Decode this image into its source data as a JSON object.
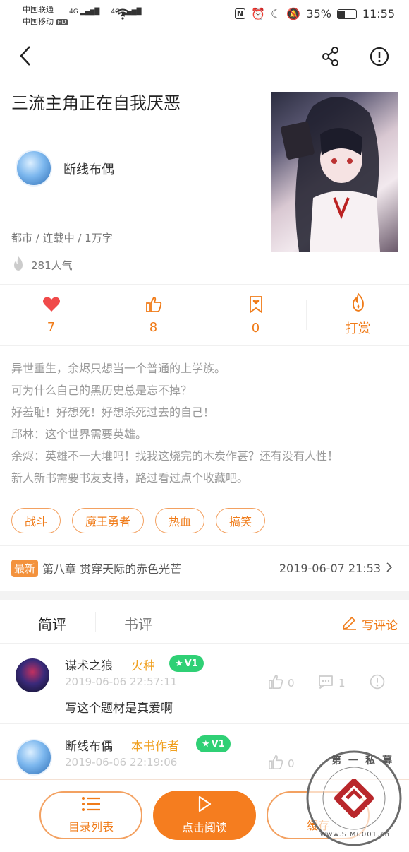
{
  "status_bar": {
    "carrier1": "中国联通",
    "carrier2": "中国移动",
    "hd": "HD",
    "net1": "4G",
    "net2": "4G",
    "battery": "35%",
    "time": "11:55"
  },
  "book": {
    "title": "三流主角正在自我厌恶",
    "author": "断线布偶",
    "meta": "都市 / 连载中 / 1万字",
    "popularity": "281人气"
  },
  "stats": [
    {
      "icon": "heart-icon",
      "value": "7"
    },
    {
      "icon": "thumbs-up-icon",
      "value": "8"
    },
    {
      "icon": "bookmark-icon",
      "value": "0"
    },
    {
      "icon": "flame-icon",
      "value": "打赏"
    }
  ],
  "description": [
    "异世重生，余烬只想当一个普通的上学族。",
    "可为什么自己的黑历史总是忘不掉？",
    "好羞耻！好想死！好想杀死过去的自己！",
    "邱林：这个世界需要英雄。",
    "余烬：英雄不一大堆吗！找我这烧完的木炭作甚？还有没有人性！",
    "新人新书需要书友支持，路过看过点个收藏吧。"
  ],
  "tags": [
    "战斗",
    "魔王勇者",
    "热血",
    "搞笑"
  ],
  "latest": {
    "badge": "最新",
    "chapter": "第八章 贯穿天际的赤色光芒",
    "time": "2019-06-07 21:53"
  },
  "tabs": {
    "short": "简评",
    "book": "书评",
    "write": "写评论"
  },
  "reviews": [
    {
      "name": "谋术之狼",
      "title": "火种",
      "level": "V1",
      "time": "2019-06-06 22:57:11",
      "likes": "0",
      "comments": "1",
      "content": "写这个题材是真爱啊"
    },
    {
      "name": "断线布偶",
      "title": "本书作者",
      "level": "V1",
      "time": "2019-06-06 22:19:06",
      "likes": "0",
      "comments": ""
    }
  ],
  "bottom": {
    "catalog": "目录列表",
    "read": "点击阅读",
    "cache": "缓存"
  },
  "watermark": {
    "text": "第一私募",
    "url": "www.SiMu001.cn"
  },
  "colors": {
    "accent": "#f07b18",
    "heart": "#f04a4a",
    "vip": "#2fd075"
  }
}
